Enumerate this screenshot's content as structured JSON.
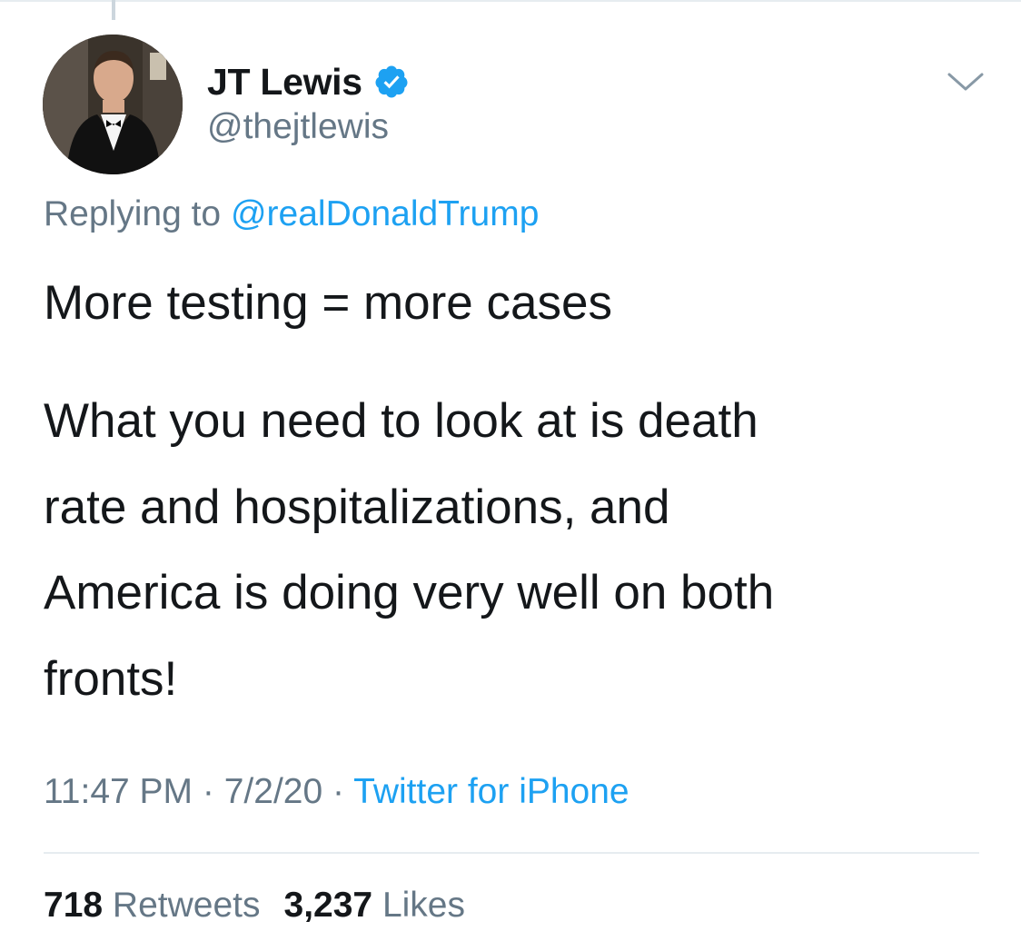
{
  "author": {
    "display_name": "JT Lewis",
    "handle": "@thejtlewis",
    "verified": true,
    "verified_color": "#1da1f2"
  },
  "reply": {
    "prefix": "Replying to",
    "mention": "@realDonaldTrump"
  },
  "tweet": {
    "line1": "More testing = more cases",
    "body_lines": [
      "What you need to look at is death",
      "rate and hospitalizations, and",
      "America is doing very well on both",
      "fronts!"
    ]
  },
  "meta": {
    "time": "11:47 PM",
    "date": "7/2/20",
    "separator": "·",
    "source": "Twitter for iPhone"
  },
  "stats": {
    "retweets_count": "718",
    "retweets_label": "Retweets",
    "likes_count": "3,237",
    "likes_label": "Likes"
  },
  "colors": {
    "text_primary": "#14171a",
    "text_secondary": "#657786",
    "link": "#1da1f2",
    "divider": "#e6ecf0"
  },
  "icons": {
    "verified": "verified-badge-icon",
    "menu": "chevron-down-icon"
  }
}
